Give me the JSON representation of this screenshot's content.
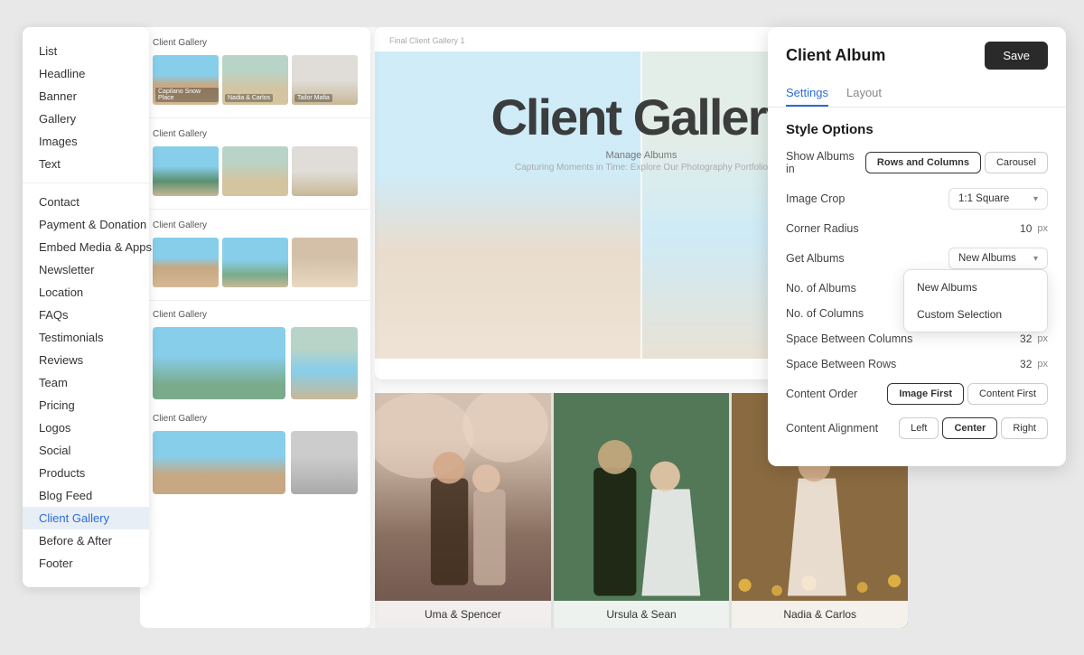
{
  "sidebar": {
    "items": [
      {
        "label": "List",
        "active": false
      },
      {
        "label": "Headline",
        "active": false
      },
      {
        "label": "Banner",
        "active": false
      },
      {
        "label": "Gallery",
        "active": false
      },
      {
        "label": "Images",
        "active": false
      },
      {
        "label": "Text",
        "active": false
      },
      {
        "label": "Contact",
        "active": false
      },
      {
        "label": "Payment & Donation",
        "active": false
      },
      {
        "label": "Embed Media & Apps",
        "active": false
      },
      {
        "label": "Newsletter",
        "active": false
      },
      {
        "label": "Location",
        "active": false
      },
      {
        "label": "FAQs",
        "active": false
      },
      {
        "label": "Testimonials",
        "active": false
      },
      {
        "label": "Reviews",
        "active": false
      },
      {
        "label": "Team",
        "active": false
      },
      {
        "label": "Pricing",
        "active": false
      },
      {
        "label": "Logos",
        "active": false
      },
      {
        "label": "Social",
        "active": false
      },
      {
        "label": "Products",
        "active": false
      },
      {
        "label": "Blog Feed",
        "active": false
      },
      {
        "label": "Client Gallery",
        "active": true
      },
      {
        "label": "Before & After",
        "active": false
      },
      {
        "label": "Footer",
        "active": false
      }
    ]
  },
  "gallery_panel": {
    "sections": [
      {
        "title": "Client Gallery"
      },
      {
        "title": "Client Gallery"
      },
      {
        "title": "Client Gallery"
      },
      {
        "title": "Client Gallery"
      },
      {
        "title": "Client Gallery"
      }
    ]
  },
  "hero_gallery": {
    "header": "Client Gallery",
    "tag": "Final Client Gallery 1",
    "manage": "Manage Albums",
    "title": "Client Gallery",
    "big_title": "Client Gallery",
    "subtitle": "Capturing Moments in Time: Explore Our Photography Portfolio"
  },
  "wedding": {
    "couples": [
      {
        "name": "Uma & Spencer"
      },
      {
        "name": "Ursula & Sean"
      },
      {
        "name": "Nadia & Carlos"
      }
    ]
  },
  "style_panel": {
    "title": "Client Album",
    "save_label": "Save",
    "tabs": [
      {
        "label": "Settings",
        "active": true
      },
      {
        "label": "Layout",
        "active": false
      }
    ],
    "section_title": "Style Options",
    "options": [
      {
        "label": "Show Albums in",
        "type": "toggle_group",
        "buttons": [
          {
            "label": "Rows and Columns",
            "active": true
          },
          {
            "label": "Carousel",
            "active": false
          }
        ]
      },
      {
        "label": "Image Crop",
        "type": "select",
        "value": "1:1 Square"
      },
      {
        "label": "Corner Radius",
        "type": "number",
        "value": "10",
        "unit": "px"
      },
      {
        "label": "Get Albums",
        "type": "select",
        "value": "New Albums",
        "dropdown_open": true,
        "dropdown_items": [
          "New Albums",
          "Custom Selection"
        ]
      },
      {
        "label": "No. of Albums",
        "type": "text",
        "value": ""
      },
      {
        "label": "No. of Columns",
        "type": "text",
        "value": ""
      },
      {
        "label": "Space Between Columns",
        "type": "number",
        "value": "32",
        "unit": "px"
      },
      {
        "label": "Space Between Rows",
        "type": "number",
        "value": "32",
        "unit": "px"
      },
      {
        "label": "Content Order",
        "type": "toggle_group",
        "buttons": [
          {
            "label": "Image First",
            "active": true
          },
          {
            "label": "Content First",
            "active": false
          }
        ]
      },
      {
        "label": "Content Alignment",
        "type": "toggle_group",
        "buttons": [
          {
            "label": "Left",
            "active": false
          },
          {
            "label": "Center",
            "active": true
          },
          {
            "label": "Right",
            "active": false
          }
        ]
      }
    ]
  }
}
